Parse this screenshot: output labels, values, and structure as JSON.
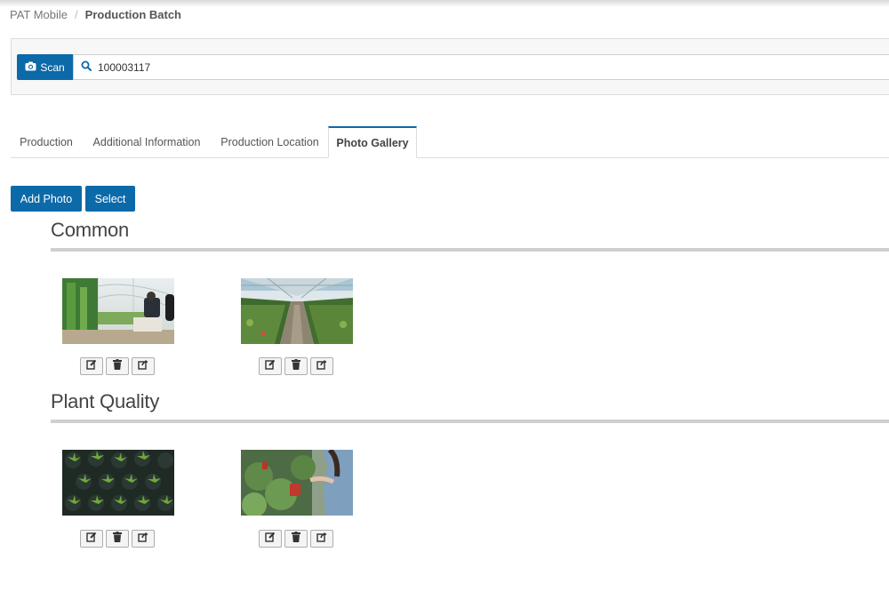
{
  "breadcrumb": {
    "root": "PAT Mobile",
    "separator": "/",
    "current": "Production Batch"
  },
  "scan": {
    "button_label": "Scan",
    "value": "100003117"
  },
  "tabs": [
    {
      "label": "Production",
      "active": false
    },
    {
      "label": "Additional Information",
      "active": false
    },
    {
      "label": "Production Location",
      "active": false
    },
    {
      "label": "Photo Gallery",
      "active": true
    }
  ],
  "toolbar": {
    "add_photo_label": "Add Photo",
    "select_label": "Select"
  },
  "sections": [
    {
      "title": "Common",
      "photos": [
        {
          "subject": "greenhouse-worker"
        },
        {
          "subject": "greenhouse-aisle"
        }
      ]
    },
    {
      "title": "Plant Quality",
      "photos": [
        {
          "subject": "seedlings-top-view"
        },
        {
          "subject": "person-with-potted-plants"
        }
      ]
    }
  ],
  "photo_actions": [
    "edit-icon",
    "trash-icon",
    "share-icon"
  ],
  "colors": {
    "primary": "#0c6aa8",
    "rule": "#cfcfcf",
    "tab_border": "#dddddd"
  }
}
